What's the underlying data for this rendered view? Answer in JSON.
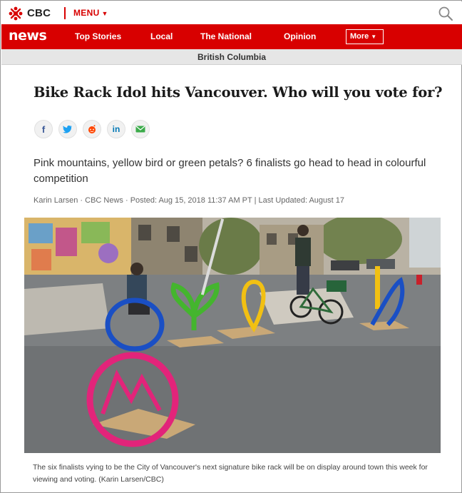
{
  "header": {
    "brand": "CBC",
    "menu_label": "MENU",
    "logo_icon": "cbc-gem-icon",
    "search_icon": "search-icon",
    "accent": "#d80000"
  },
  "nav": {
    "brand": "news",
    "items": [
      {
        "label": "Top Stories"
      },
      {
        "label": "Local"
      },
      {
        "label": "The National"
      },
      {
        "label": "Opinion"
      }
    ],
    "more_label": "More",
    "background": "#d80000"
  },
  "region": {
    "label": "British Columbia"
  },
  "article": {
    "headline": "Bike Rack Idol hits Vancouver. Who will you vote for?",
    "share_icons": [
      "facebook-icon",
      "twitter-icon",
      "reddit-icon",
      "linkedin-icon",
      "email-icon"
    ],
    "deck": "Pink mountains, yellow bird or green petals? 6 finalists go head to head in colourful competition",
    "byline": "Karin Larsen · CBC News · Posted: Aug 15, 2018 11:37 AM PT | Last Updated: August 17",
    "photo_subject": "bike-racks-on-street-photo",
    "caption": "The six finalists vying to be the City of Vancouver's next signature bike rack will be on display around town this week for viewing and voting. (Karin Larsen/CBC)"
  }
}
